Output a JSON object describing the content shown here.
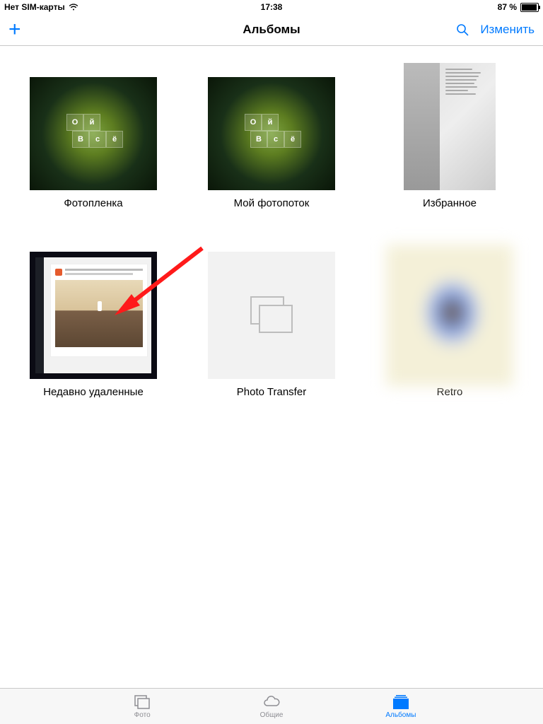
{
  "status": {
    "sim": "Нет SIM-карты",
    "time": "17:38",
    "battery_pct": "87 %"
  },
  "nav": {
    "title": "Альбомы",
    "edit": "Изменить"
  },
  "albums": [
    {
      "label": "Фотопленка"
    },
    {
      "label": "Мой фотопоток"
    },
    {
      "label": "Избранное"
    },
    {
      "label": "Недавно удаленные"
    },
    {
      "label": "Photo Transfer"
    },
    {
      "label": "Retro"
    }
  ],
  "smoke_tiles": {
    "t0": "О",
    "t1": "й",
    "t2": "В",
    "t3": "с",
    "t4": "ё"
  },
  "tabs": {
    "photos": "Фото",
    "shared": "Общие",
    "albums": "Альбомы"
  }
}
